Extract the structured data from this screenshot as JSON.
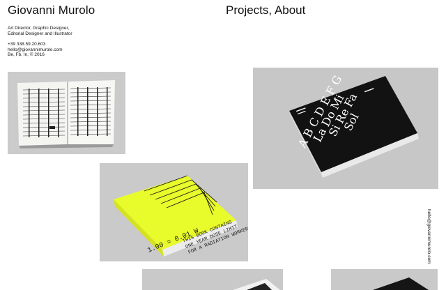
{
  "header": {
    "site_title": "Giovanni Murolo",
    "nav": {
      "projects": "Projects",
      "separator": ", ",
      "about": "About"
    }
  },
  "bio": {
    "role_line1": "Art Director, Graphic Designer,",
    "role_line2": "Editorial Designer and Illustrator",
    "phone": "+39 338.59.20.603",
    "email": "hello@giovannimurolo.com",
    "social_copyright": "Be, Fb, In, © 2016"
  },
  "side_email": "hello@giovannimurolo.com",
  "projects": [
    {
      "id": "open-book"
    },
    {
      "id": "black-book",
      "cover_letters": [
        "A",
        "B",
        "C",
        "D",
        "E",
        "F",
        "G",
        "La",
        "Si",
        "Do",
        "Re",
        "Mi",
        "Fa",
        "Sol"
      ]
    },
    {
      "id": "yellow-book",
      "cover_lines": [
        "THIS BOOK CONTAINS",
        "ONE YEAR DOSE LIMIT",
        "FOR A RADIATION WORKER"
      ],
      "cover_number": "1.00 = 0.01 W"
    },
    {
      "id": "project-4"
    },
    {
      "id": "project-5"
    }
  ],
  "colors": {
    "background": "#ffffff",
    "text": "#111111",
    "tile_bg": "#c9c9c9",
    "neon_yellow": "#e8fb2b",
    "book_black": "#111111"
  }
}
